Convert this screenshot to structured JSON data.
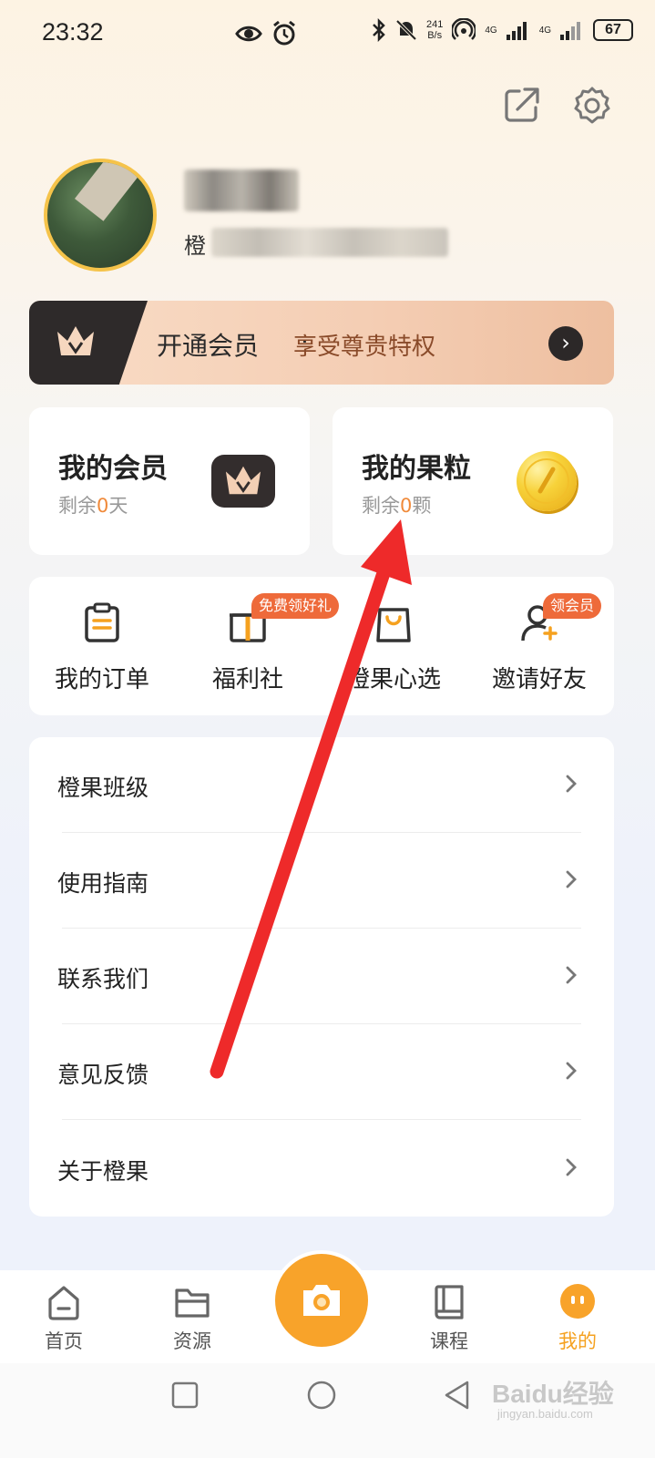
{
  "status_bar": {
    "time": "23:32",
    "speed_value": "241",
    "speed_unit": "B/s",
    "signal_1": "4G",
    "signal_2": "4G",
    "battery": "67"
  },
  "profile": {
    "sub_prefix": "橙"
  },
  "vip_banner": {
    "title": "开通会员",
    "separator": "·",
    "subtitle": "享受尊贵特权",
    "arrow": "›"
  },
  "member_card": {
    "title": "我的会员",
    "sub_prefix": "剩余",
    "count": "0",
    "sub_suffix": "天"
  },
  "points_card": {
    "title": "我的果粒",
    "sub_prefix": "剩余",
    "count": "0",
    "sub_suffix": "颗"
  },
  "quick_actions": [
    {
      "label": "我的订单",
      "icon": "clipboard-icon"
    },
    {
      "label": "福利社",
      "icon": "gift-icon",
      "badge": "免费领好礼"
    },
    {
      "label": "橙果心选",
      "icon": "shopping-bag-icon"
    },
    {
      "label": "邀请好友",
      "icon": "add-user-icon",
      "badge": "领会员"
    }
  ],
  "menu": [
    {
      "label": "橙果班级"
    },
    {
      "label": "使用指南"
    },
    {
      "label": "联系我们"
    },
    {
      "label": "意见反馈"
    },
    {
      "label": "关于橙果"
    }
  ],
  "bottom_nav": [
    {
      "label": "首页",
      "icon": "home-icon"
    },
    {
      "label": "资源",
      "icon": "folder-icon"
    },
    {
      "label": "课程",
      "icon": "book-icon"
    },
    {
      "label": "我的",
      "icon": "profile-face-icon",
      "active": true
    }
  ],
  "watermark": {
    "main": "Baidu经验",
    "sub": "jingyan.baidu.com"
  },
  "colors": {
    "accent": "#f8a32a",
    "highlight": "#f08a3a",
    "badge": "#ee6a3a",
    "arrow": "#ee2a2a"
  }
}
